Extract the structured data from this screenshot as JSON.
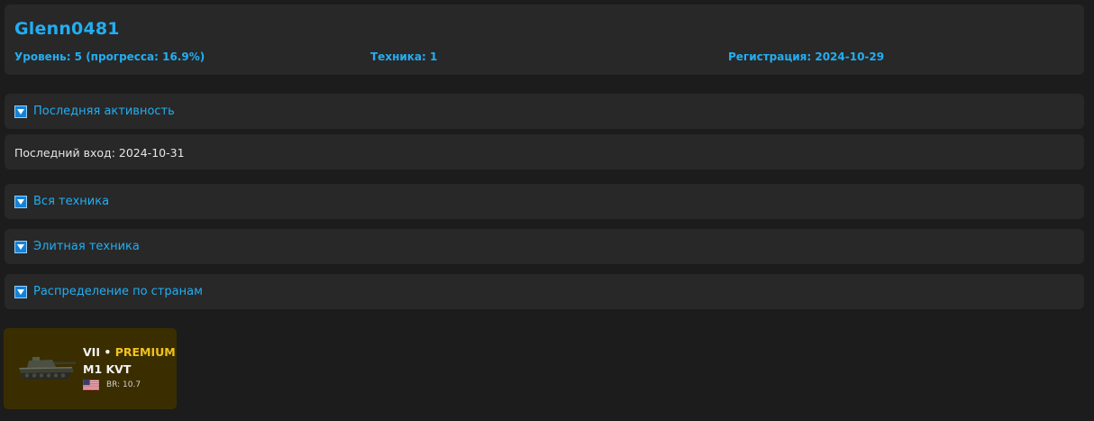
{
  "profile": {
    "username": "Glenn0481",
    "level": "Уровень: 5 (прогресса: 16.9%)",
    "vehicles": "Техника: 1",
    "registration": "Регистрация: 2024-10-29"
  },
  "sections": {
    "recent_activity": {
      "title": "Последняя активность",
      "content": "Последний вход: 2024-10-31"
    },
    "all_vehicles": {
      "title": "Вся техника"
    },
    "elite_vehicles": {
      "title": "Элитная техника"
    },
    "country_distribution": {
      "title": "Распределение по странам"
    }
  },
  "vehicle": {
    "tier": "VII",
    "separator": "•",
    "type": "PREMIUM",
    "name": "M1 KVT",
    "country_flag": "usa-flag-icon",
    "br": "BR: 10.7"
  },
  "colors": {
    "accent": "#22aef2",
    "panel": "#282828",
    "background": "#1c1c1c",
    "premium": "#f1c21b",
    "card": "#3a2e00"
  }
}
